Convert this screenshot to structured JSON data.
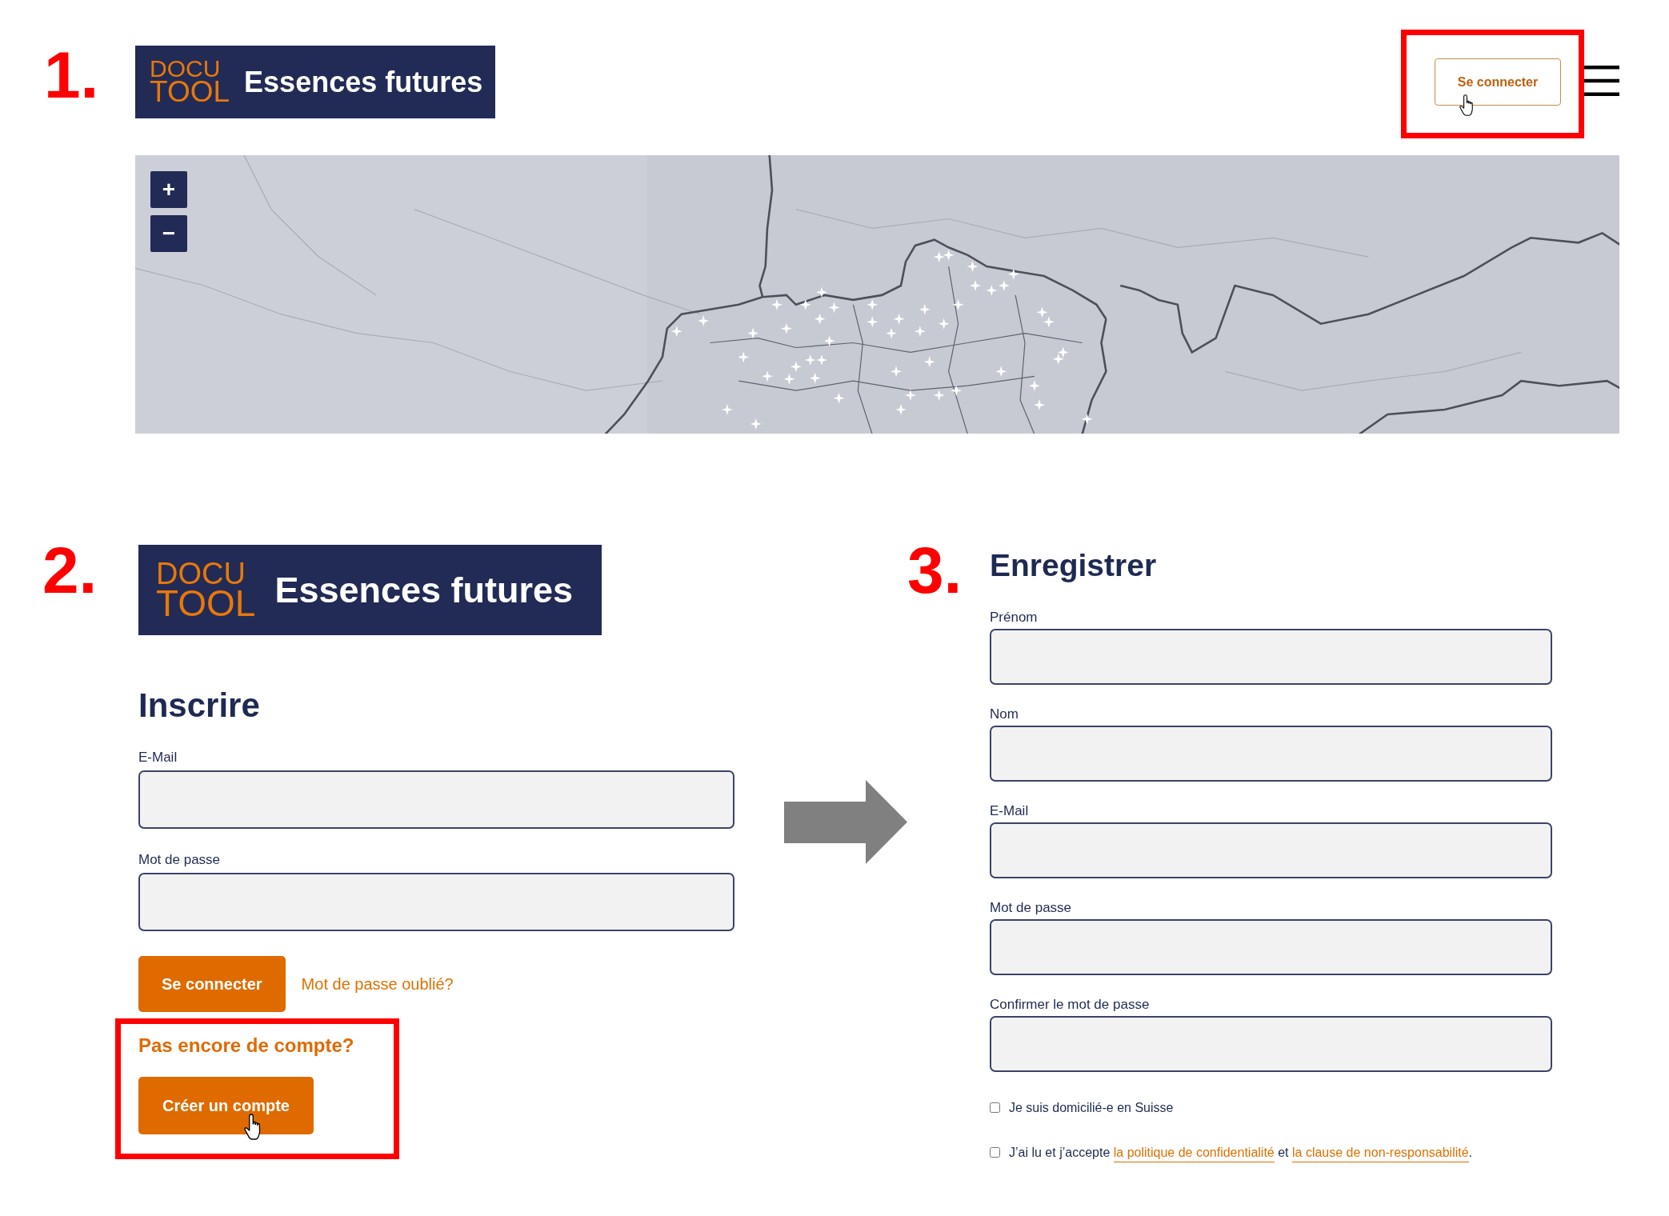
{
  "home_page": {
    "number": "1.",
    "logo": {
      "line_1": "DOCU",
      "line_2": "TOOL",
      "title": "Essences futures"
    },
    "login_button": {
      "label": "Se connecter",
      "highlighted": true
    },
    "map": {
      "zoom_in": "+",
      "zoom_out": "−"
    }
  },
  "login_page": {
    "number": "2.",
    "logo": {
      "line_1": "DOCU",
      "line_2": "TOOL",
      "title": "Essences futures"
    },
    "heading": "Inscrire",
    "fields": [
      {
        "label": "E-Mail"
      },
      {
        "label": "Mot de passe"
      }
    ],
    "submit_button": "Se connecter",
    "forgot_link": "Mot de passe oublié?",
    "register": {
      "prompt": "Pas encore de compte?",
      "button": "Créer un compte",
      "highlighted": true
    }
  },
  "register_page": {
    "number": "3.",
    "heading": "Enregistrer",
    "fields": [
      {
        "label": "Prénom"
      },
      {
        "label": "Nom"
      },
      {
        "label": "E-Mail"
      },
      {
        "label": "Mot de passe"
      },
      {
        "label": "Confirmer le mot de passe"
      }
    ],
    "checkboxes": [
      {
        "checked": false,
        "parts": [
          {
            "kind": "text",
            "text": "Je suis domicilié-e en Suisse"
          }
        ]
      },
      {
        "checked": false,
        "parts": [
          {
            "kind": "text",
            "text": "J’ai lu et j’accepte "
          },
          {
            "kind": "link",
            "text": "la politique de confidentialité"
          },
          {
            "kind": "text",
            "text": " et "
          },
          {
            "kind": "link",
            "text": "la clause de non-responsabilité"
          },
          {
            "kind": "text",
            "text": "."
          }
        ]
      }
    ]
  }
}
